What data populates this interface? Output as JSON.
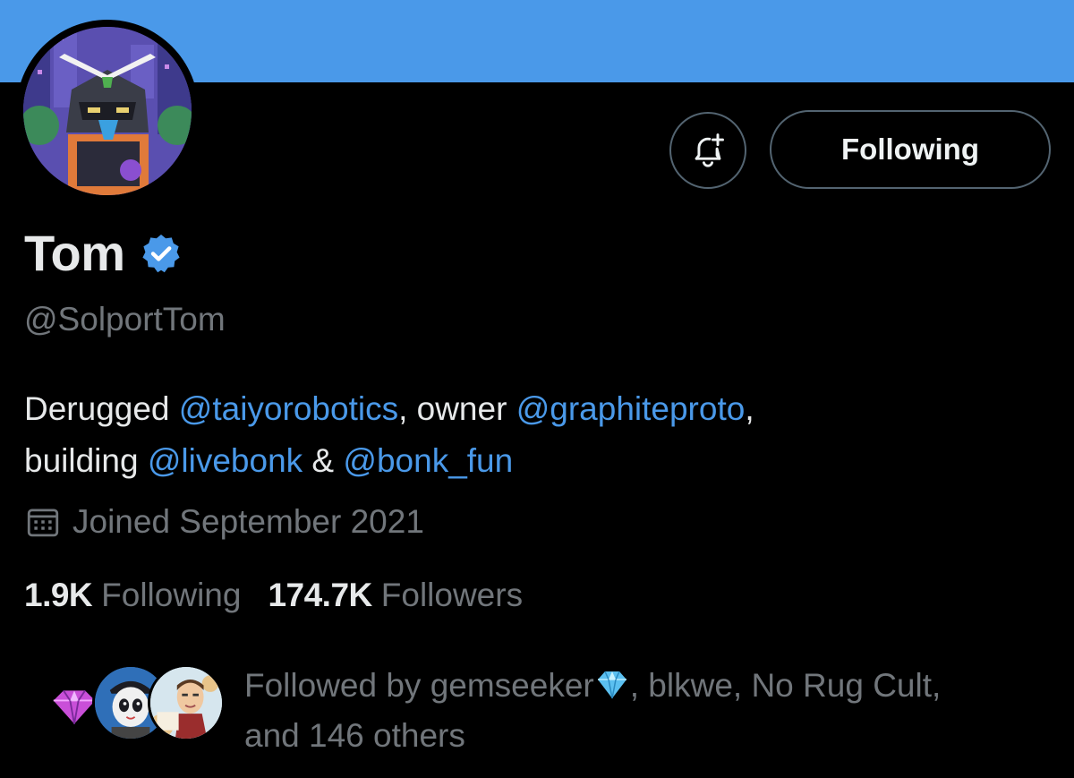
{
  "colors": {
    "banner": "#4a99e9",
    "background": "#000000",
    "text_primary": "#e7e9ea",
    "text_secondary": "#71767b",
    "link": "#4a99e9",
    "verified": "#4a99e9",
    "button_border": "#536471"
  },
  "header": {
    "follow_state_label": "Following",
    "notify_icon": "bell-plus-icon"
  },
  "profile": {
    "display_name": "Tom",
    "verified_icon": "verified-badge-icon",
    "handle": "@SolportTom",
    "bio": {
      "t1": "Derugged ",
      "m1": "@taiyorobotics",
      "t2": ", owner ",
      "m2": "@graphiteproto",
      "t3": ",",
      "t4": "building ",
      "m3": "@livebonk",
      "t5": " & ",
      "m4": "@bonk_fun"
    },
    "joined_icon": "calendar-icon",
    "joined": "Joined September 2021"
  },
  "stats": {
    "following_count": "1.9K",
    "following_label": "Following",
    "followers_count": "174.7K",
    "followers_label": "Followers"
  },
  "followed_by": {
    "prefix": "Followed by gemseeker",
    "rest": ", blkwe, No Rug Cult,",
    "line2": "and 146 others",
    "avatar_icons": [
      "diamond-avatar",
      "mascot-avatar",
      "no-rug-cult-avatar"
    ]
  }
}
